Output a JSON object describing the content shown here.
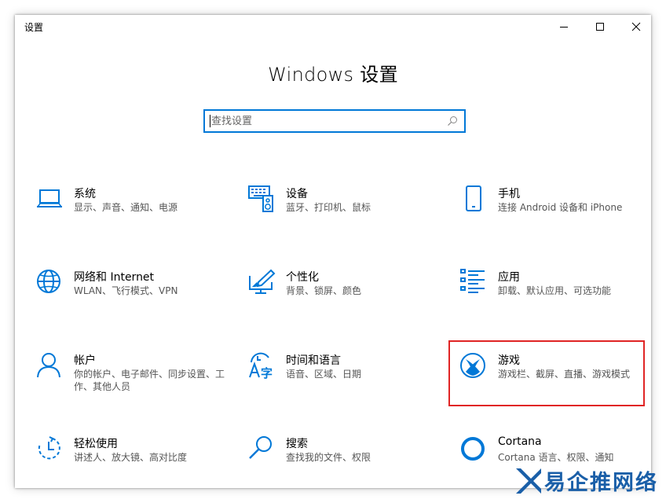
{
  "window": {
    "title": "设置"
  },
  "heading": "Windows 设置",
  "search": {
    "placeholder": "查找设置"
  },
  "accent_color": "#0078d7",
  "highlight_color": "#e02525",
  "tiles": [
    {
      "icon": "laptop-icon",
      "title": "系统",
      "desc": "显示、声音、通知、电源"
    },
    {
      "icon": "keyboard-speaker-icon",
      "title": "设备",
      "desc": "蓝牙、打印机、鼠标"
    },
    {
      "icon": "phone-icon",
      "title": "手机",
      "desc": "连接 Android 设备和 iPhone"
    },
    {
      "icon": "globe-icon",
      "title": "网络和 Internet",
      "desc": "WLAN、飞行模式、VPN"
    },
    {
      "icon": "paint-brush-icon",
      "title": "个性化",
      "desc": "背景、锁屏、颜色"
    },
    {
      "icon": "apps-list-icon",
      "title": "应用",
      "desc": "卸载、默认应用、可选功能"
    },
    {
      "icon": "person-icon",
      "title": "帐户",
      "desc": "你的帐户、电子邮件、同步设置、工作、其他人员"
    },
    {
      "icon": "language-icon",
      "title": "时间和语言",
      "desc": "语音、区域、日期"
    },
    {
      "icon": "xbox-icon",
      "title": "游戏",
      "desc": "游戏栏、截屏、直播、游戏模式"
    },
    {
      "icon": "ease-of-access-icon",
      "title": "轻松使用",
      "desc": "讲述人、放大镜、高对比度"
    },
    {
      "icon": "search-icon",
      "title": "搜索",
      "desc": "查找我的文件、权限"
    },
    {
      "icon": "cortana-icon",
      "title": "Cortana",
      "desc": "Cortana 语言、权限、通知"
    }
  ],
  "watermark": {
    "text": "易企推网络"
  }
}
